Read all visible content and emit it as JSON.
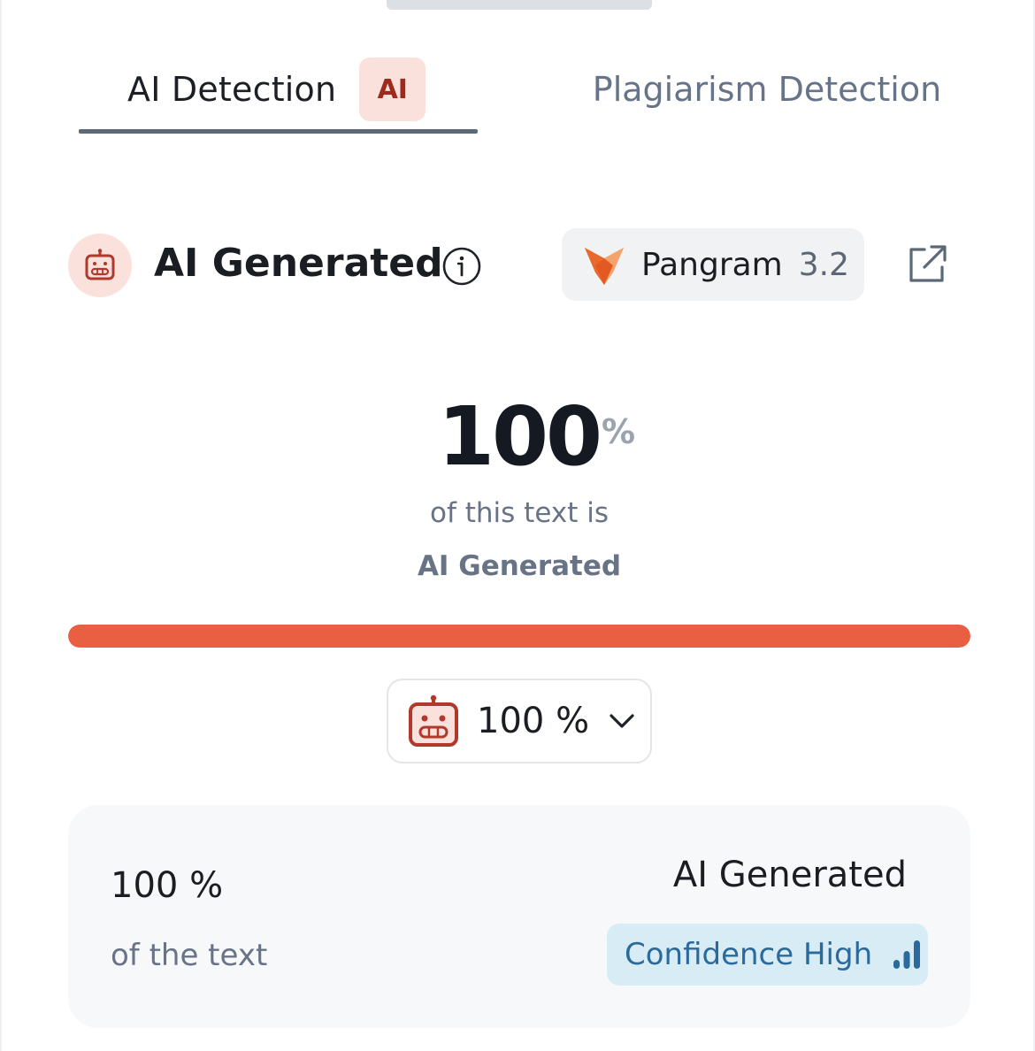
{
  "tabs": {
    "ai_detection": {
      "label": "AI Detection",
      "badge": "AI"
    },
    "plagiarism": {
      "label": "Plagiarism Detection"
    }
  },
  "header": {
    "title": "AI Generated",
    "model_name": "Pangram",
    "model_version": "3.2"
  },
  "result": {
    "percent_value": "100",
    "percent_unit": "%",
    "line1": "of this text is",
    "line2": "AI Generated",
    "progress_fraction": 1.0,
    "progress_color": "#e85f42"
  },
  "dropdown": {
    "value": "100 %"
  },
  "summary": {
    "percent": "100 %",
    "percent_label": "of the text",
    "classification": "AI Generated",
    "confidence": "Confidence High"
  },
  "icons": {
    "robot": "robot-icon",
    "info": "info-icon",
    "pangram_logo": "fox-logo-icon",
    "external": "external-link-icon",
    "chevron": "chevron-down-icon",
    "signal": "signal-bars-icon"
  },
  "colors": {
    "accent": "#e85f42",
    "robot_bg": "#fbe1db",
    "robot_fg": "#b0392b",
    "confidence_bg": "#d8ecf5",
    "confidence_fg": "#2b6a9a"
  }
}
